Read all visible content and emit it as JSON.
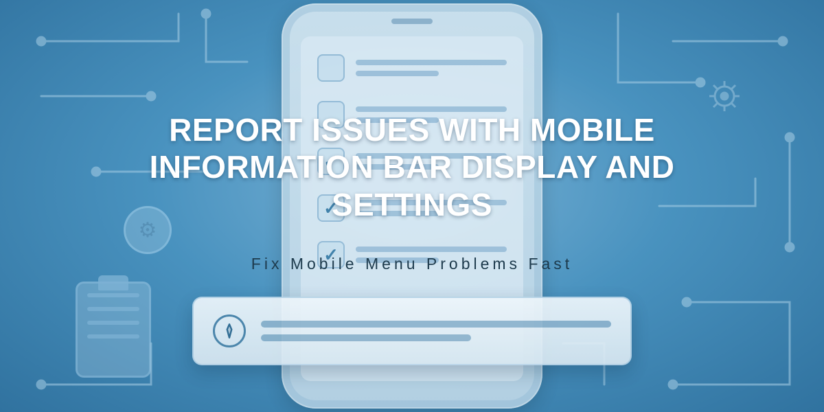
{
  "hero": {
    "title": "REPORT ISSUES WITH MOBILE INFORMATION BAR DISPLAY AND SETTINGS",
    "subtitle": "Fix Mobile Menu Problems Fast"
  },
  "phone": {
    "rows": [
      {
        "checked": false
      },
      {
        "checked": false
      },
      {
        "checked": true
      },
      {
        "checked": true
      },
      {
        "checked": true
      }
    ]
  },
  "notification_bar": {
    "icon_name": "compass-icon"
  },
  "colors": {
    "bg_primary": "#4d98c4",
    "text_light": "#ffffff",
    "text_dark": "#1d3a4c"
  }
}
